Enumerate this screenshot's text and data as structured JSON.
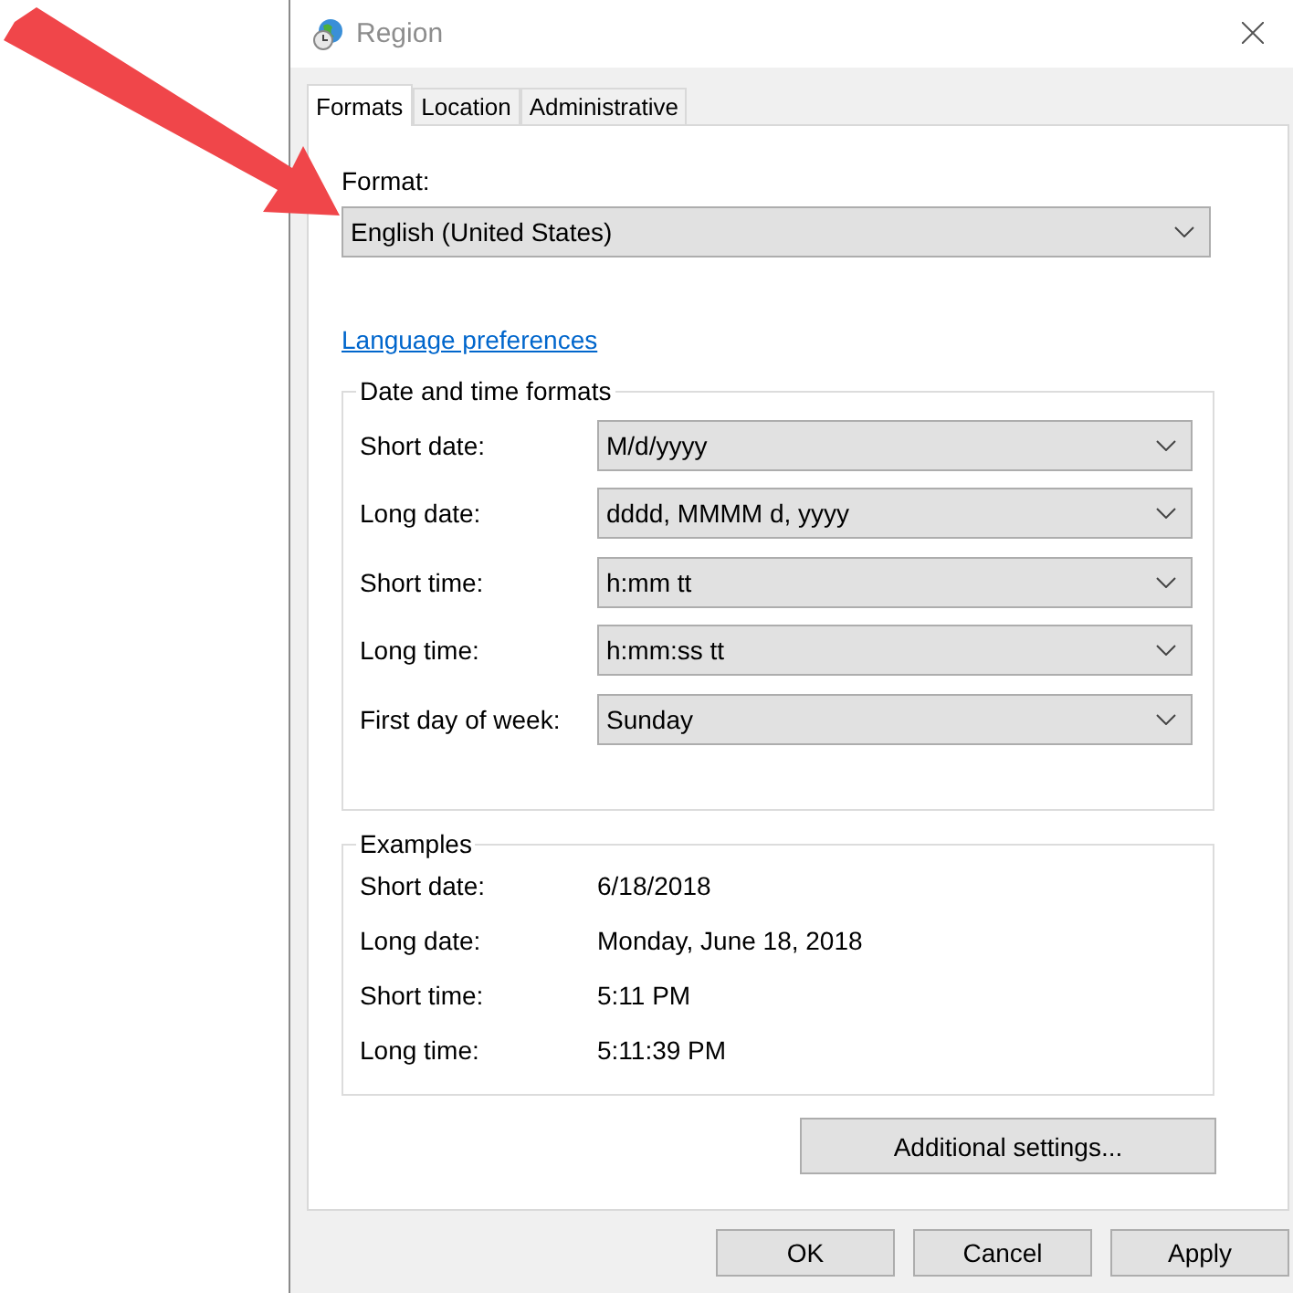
{
  "window": {
    "title": "Region"
  },
  "tabs": [
    {
      "label": "Formats",
      "selected": true
    },
    {
      "label": "Location",
      "selected": false
    },
    {
      "label": "Administrative",
      "selected": false
    }
  ],
  "format": {
    "label": "Format:",
    "value": "English (United States)"
  },
  "language_link": "Language preferences",
  "date_time_formats": {
    "title": "Date and time formats",
    "rows": [
      {
        "label": "Short date:",
        "value": "M/d/yyyy"
      },
      {
        "label": "Long date:",
        "value": "dddd, MMMM d, yyyy"
      },
      {
        "label": "Short time:",
        "value": "h:mm tt"
      },
      {
        "label": "Long time:",
        "value": "h:mm:ss tt"
      },
      {
        "label": "First day of week:",
        "value": "Sunday"
      }
    ]
  },
  "examples": {
    "title": "Examples",
    "rows": [
      {
        "label": "Short date:",
        "value": "6/18/2018"
      },
      {
        "label": "Long date:",
        "value": "Monday, June 18, 2018"
      },
      {
        "label": "Short time:",
        "value": "5:11 PM"
      },
      {
        "label": "Long time:",
        "value": "5:11:39 PM"
      }
    ]
  },
  "additional_button": "Additional settings...",
  "buttons": [
    "OK",
    "Cancel",
    "Apply"
  ]
}
